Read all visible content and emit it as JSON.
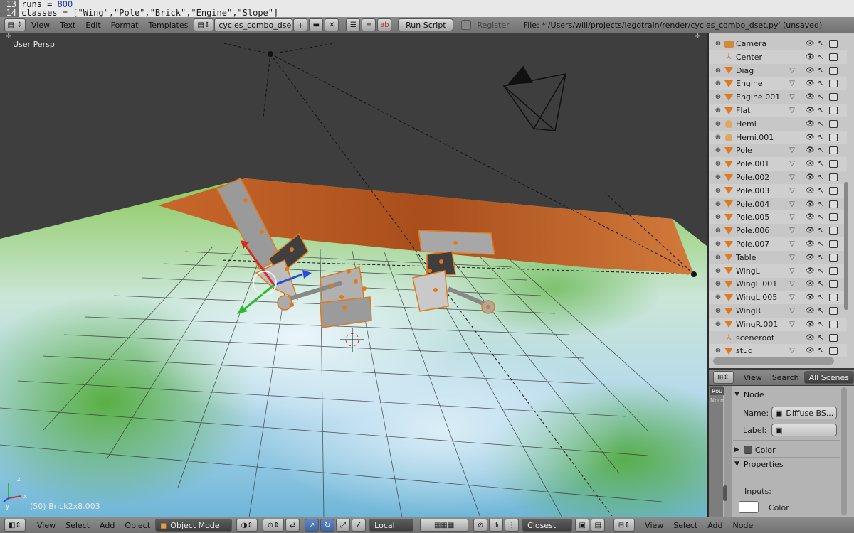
{
  "code": {
    "line13_num": "13",
    "line13_text": "runs = ",
    "line13_value": "800",
    "line14_num": "14",
    "line14_text": "classes = [\"Wing\",\"Pole\",\"Brick\",\"Engine\",\"Slope\"]"
  },
  "text_header": {
    "menu": [
      "View",
      "Text",
      "Edit",
      "Format",
      "Templates"
    ],
    "script_name": "cycles_combo_dse...",
    "run_script": "Run Script",
    "register": "Register",
    "file_path": "File: *'/Users/will/projects/legotrain/render/cycles_combo_dset.py' (unsaved)"
  },
  "viewport": {
    "view_label": "User Persp",
    "status": "(50) Brick2x8.003",
    "axis_z": "z",
    "axis_x": "x",
    "axis_y": "y"
  },
  "outliner": {
    "items": [
      {
        "name": "Camera",
        "type": "camera"
      },
      {
        "name": "Center",
        "type": "empty"
      },
      {
        "name": "Diag",
        "type": "mesh"
      },
      {
        "name": "Engine",
        "type": "mesh"
      },
      {
        "name": "Engine.001",
        "type": "mesh"
      },
      {
        "name": "Flat",
        "type": "mesh"
      },
      {
        "name": "Hemi",
        "type": "lamp"
      },
      {
        "name": "Hemi.001",
        "type": "lamp"
      },
      {
        "name": "Pole",
        "type": "mesh"
      },
      {
        "name": "Pole.001",
        "type": "mesh"
      },
      {
        "name": "Pole.002",
        "type": "mesh"
      },
      {
        "name": "Pole.003",
        "type": "mesh"
      },
      {
        "name": "Pole.004",
        "type": "mesh"
      },
      {
        "name": "Pole.005",
        "type": "mesh"
      },
      {
        "name": "Pole.006",
        "type": "mesh"
      },
      {
        "name": "Pole.007",
        "type": "mesh"
      },
      {
        "name": "Table",
        "type": "mesh"
      },
      {
        "name": "WingL",
        "type": "mesh"
      },
      {
        "name": "WingL.001",
        "type": "mesh"
      },
      {
        "name": "WingL.005",
        "type": "mesh"
      },
      {
        "name": "WingR",
        "type": "mesh"
      },
      {
        "name": "WingR.001",
        "type": "mesh"
      },
      {
        "name": "sceneroot",
        "type": "empty"
      },
      {
        "name": "stud",
        "type": "mesh"
      }
    ],
    "header": {
      "view": "View",
      "search": "Search",
      "scope": "All Scenes"
    }
  },
  "props": {
    "node_panel": "Node",
    "name_label": "Name:",
    "name_value": "Diffuse BS...",
    "label_label": "Label:",
    "color_panel": "Color",
    "properties_panel": "Properties",
    "inputs_label": "Inputs:",
    "color_label": "Color",
    "side_tab1": "Rou",
    "side_tab2": "Norm"
  },
  "bottom_header": {
    "menu": [
      "View",
      "Select",
      "Add",
      "Object"
    ],
    "mode": "Object Mode",
    "orientation": "Local",
    "snap": "Closest",
    "right_menu": [
      "View",
      "Select",
      "Add",
      "Node"
    ]
  },
  "colors": {
    "header": "#7f7f7f",
    "accent_orange": "#e0791e",
    "select_blue": "#5680c2"
  }
}
